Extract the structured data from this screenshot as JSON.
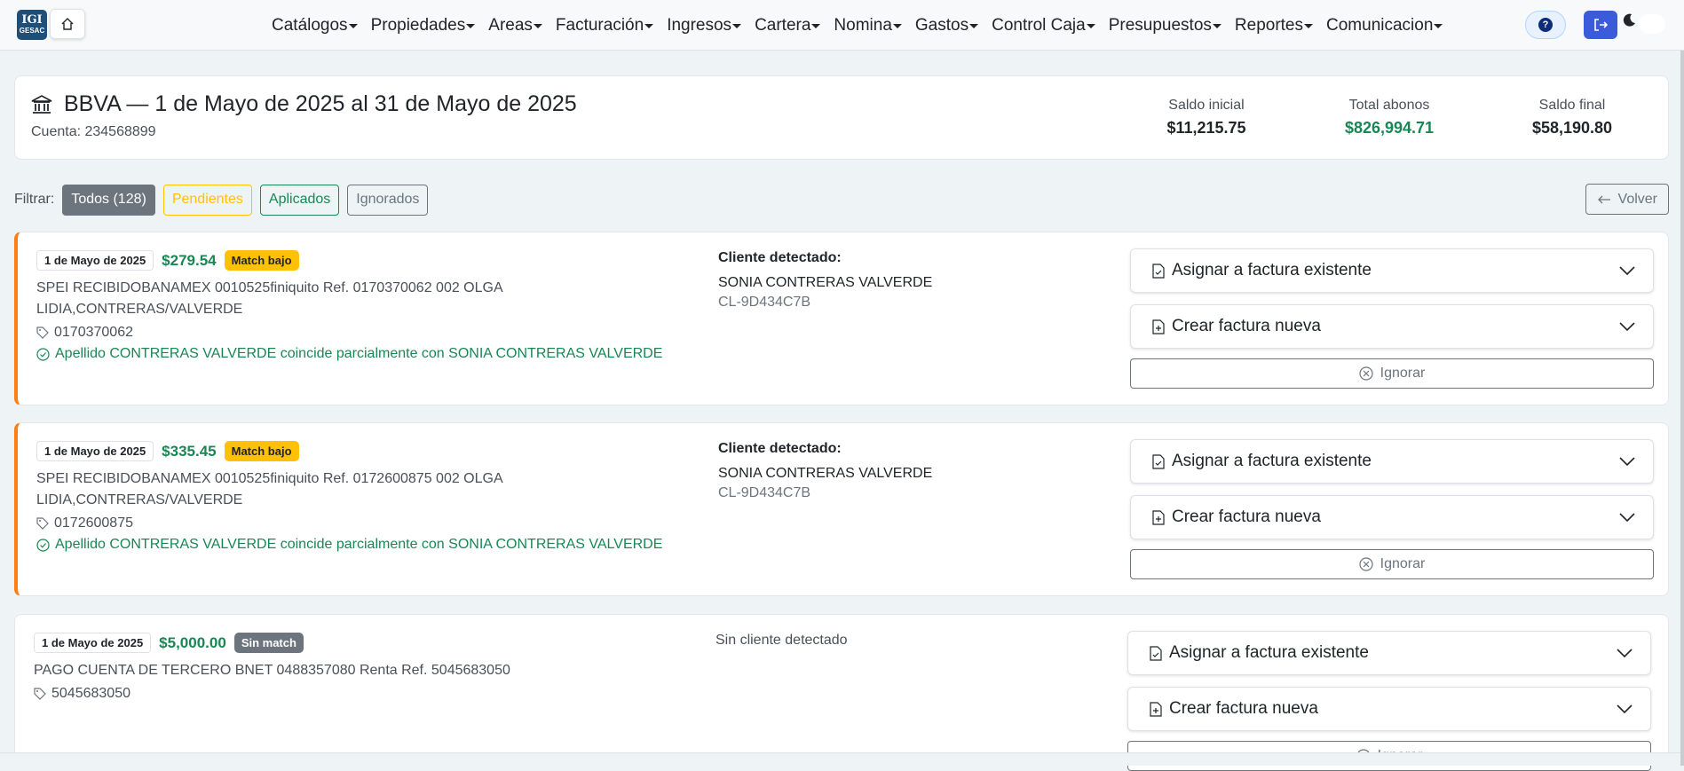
{
  "nav": {
    "logo_top": "IGI",
    "logo_bottom": "GESAC",
    "menu": [
      "Catálogos",
      "Propiedades",
      "Areas",
      "Facturación",
      "Ingresos",
      "Cartera",
      "Nomina",
      "Gastos",
      "Control Caja",
      "Presupuestos",
      "Reportes",
      "Comunicacion"
    ],
    "help_label": "?"
  },
  "header": {
    "title": "BBVA — 1 de Mayo de 2025 al 31 de Mayo de 2025",
    "account": "Cuenta: 234568899",
    "stats": [
      {
        "label": "Saldo inicial",
        "value": "$11,215.75"
      },
      {
        "label": "Total abonos",
        "value": "$826,994.71"
      },
      {
        "label": "Saldo final",
        "value": "$58,190.80"
      }
    ]
  },
  "filters": {
    "label": "Filtrar:",
    "all": "Todos (128)",
    "pending": "Pendientes",
    "applied": "Aplicados",
    "ignored": "Ignorados",
    "back": "Volver"
  },
  "actions": {
    "assign": "Asignar a factura existente",
    "create": "Crear factura nueva",
    "ignore": "Ignorar",
    "client_detected": "Cliente detectado:",
    "no_client": "Sin cliente detectado"
  },
  "transactions": [
    {
      "date": "1 de Mayo de 2025",
      "amount": "$279.54",
      "badge": "Match bajo",
      "description": "SPEI RECIBIDOBANAMEX 0010525finiquito Ref. 0170370062 002 OLGA LIDIA,CONTRERAS/VALVERDE",
      "ref": "0170370062",
      "note": "Apellido CONTRERAS VALVERDE coincide parcialmente con SONIA CONTRERAS VALVERDE",
      "client_name": "SONIA CONTRERAS VALVERDE",
      "client_id": "CL-9D434C7B"
    },
    {
      "date": "1 de Mayo de 2025",
      "amount": "$335.45",
      "badge": "Match bajo",
      "description": "SPEI RECIBIDOBANAMEX 0010525finiquito Ref. 0172600875 002 OLGA LIDIA,CONTRERAS/VALVERDE",
      "ref": "0172600875",
      "note": "Apellido CONTRERAS VALVERDE coincide parcialmente con SONIA CONTRERAS VALVERDE",
      "client_name": "SONIA CONTRERAS VALVERDE",
      "client_id": "CL-9D434C7B"
    },
    {
      "date": "1 de Mayo de 2025",
      "amount": "$5,000.00",
      "badge": "Sin match",
      "description": "PAGO CUENTA DE TERCERO BNET 0488357080 Renta Ref. 5045683050",
      "ref": "5045683050"
    }
  ]
}
